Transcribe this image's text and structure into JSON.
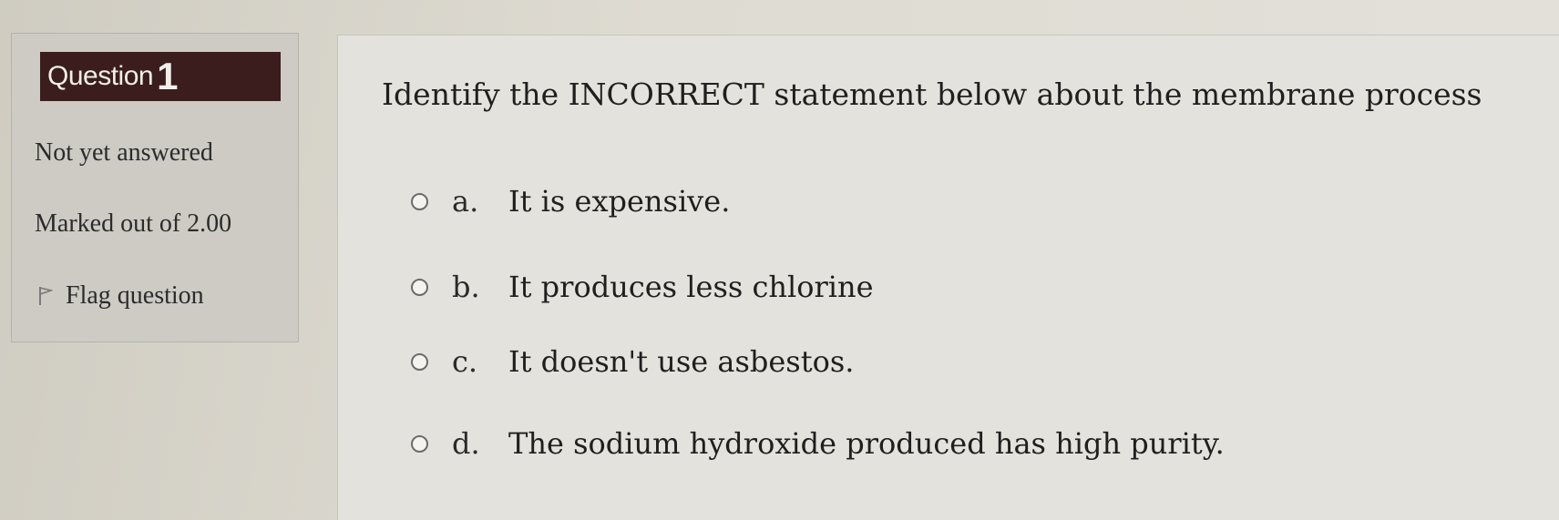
{
  "question_info": {
    "label": "Question",
    "number": "1",
    "state": "Not yet answered",
    "grade": "Marked out of 2.00",
    "flag_label": "Flag question"
  },
  "question": {
    "text": "Identify the INCORRECT statement below about the membrane process",
    "options": [
      {
        "letter": "a.",
        "text": "It is expensive."
      },
      {
        "letter": "b.",
        "text": "It produces less chlorine"
      },
      {
        "letter": "c.",
        "text": "It doesn't use asbestos."
      },
      {
        "letter": "d.",
        "text": "The sodium hydroxide produced has high purity."
      }
    ]
  },
  "colors": {
    "badge_bg": "#3a1d1c",
    "info_panel_bg": "#cdcbc4",
    "content_bg": "#e4e2dc"
  },
  "icons": {
    "flag": "flag-icon",
    "radio": "radio-unchecked-icon"
  }
}
